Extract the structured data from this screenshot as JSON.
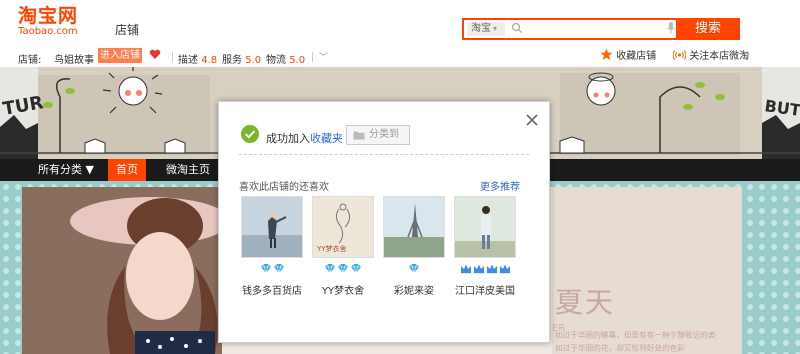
{
  "header": {
    "logo_cn": "淘宝网",
    "logo_en": "Taobao.com",
    "shop_word": "店铺",
    "search": {
      "type": "淘宝",
      "placeholder": "",
      "button": "搜索"
    }
  },
  "shop_bar": {
    "shop_label": "店铺:",
    "shop_name": "鸟姐故事",
    "enter_shop": "进入店铺",
    "describe_label": "描述",
    "describe_score": "4.8",
    "service_label": "服务",
    "service_score": "5.0",
    "logistics_label": "物流",
    "logistics_score": "5.0",
    "favorite_shop": "收藏店铺",
    "follow_weitao": "关注本店微淘"
  },
  "nav": {
    "items": [
      "所有分类 ▼",
      "首页",
      "微淘主页"
    ]
  },
  "promo": {
    "big_text": "夏天",
    "small_text": "ER",
    "caption1": "如过于华丽的帷幕，但是有有一种宁静致远的美感",
    "caption2": "如过于华丽的花，却又恰到好处的色彩"
  },
  "modal": {
    "success_prefix": "成功加入",
    "success_link": "收藏夹",
    "category_button": "分类到",
    "recommend_title": "喜欢此店铺的还喜欢",
    "more_link": "更多推荐",
    "shops": [
      {
        "name": "钱多多百货店",
        "diamonds": 2,
        "crown": false
      },
      {
        "name": "YY梦衣舍",
        "diamonds": 3,
        "crown": false
      },
      {
        "name": "彩妮来姿",
        "diamonds": 1,
        "crown": false
      },
      {
        "name": "江口洋皮美国",
        "crowns": 4,
        "crown": true
      }
    ],
    "thumb_text_2": "YY梦衣舍"
  },
  "colors": {
    "brand": "#ff4400",
    "link": "#3366cc",
    "diamond": "#2fa8e0",
    "crown": "#3a8ee6"
  }
}
